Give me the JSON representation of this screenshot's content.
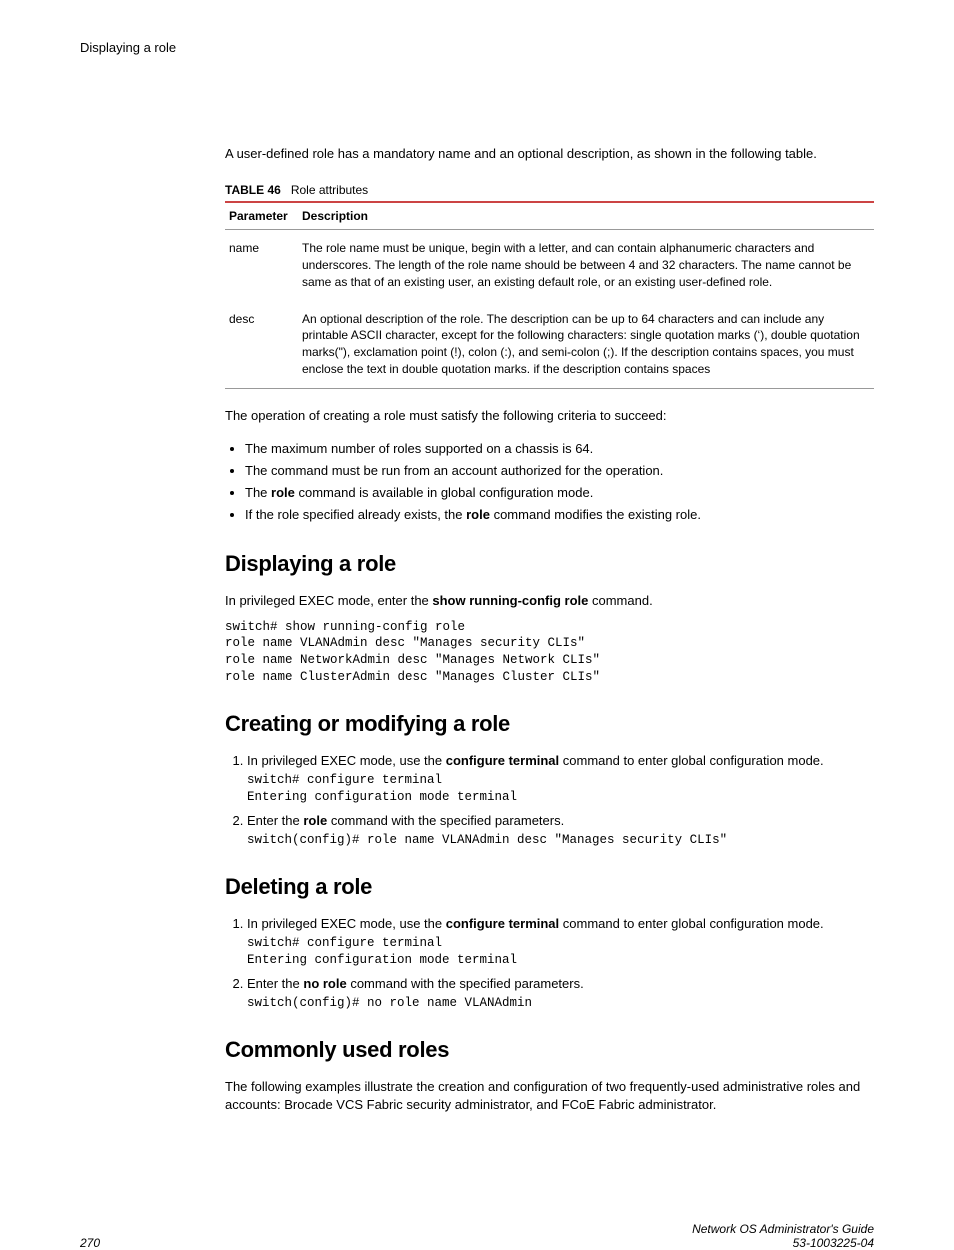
{
  "header": "Displaying a role",
  "intro": "A user-defined role has a mandatory name and an optional description, as shown in the following table.",
  "table": {
    "label": "TABLE 46",
    "title": "Role attributes",
    "col1": "Parameter",
    "col2": "Description",
    "rows": [
      {
        "param": "name",
        "desc": "The role name must be unique, begin with a letter, and can contain alphanumeric characters and underscores. The length of the role name should be between 4 and 32 characters. The name cannot be same as that of an existing user, an existing default role, or an existing user-defined role."
      },
      {
        "param": "desc",
        "desc": "An optional description of the role. The description can be up to 64 characters and can include any printable ASCII character, except for the following characters: single quotation marks (‘), double quotation marks(\"), exclamation point (!), colon (:), and semi-colon (;). If the description contains spaces, you must enclose the text in double quotation marks. if the description contains spaces"
      }
    ]
  },
  "criteria_intro": "The operation of creating a role must satisfy the following criteria to succeed:",
  "criteria": [
    {
      "text": "The maximum number of roles supported on a chassis is 64."
    },
    {
      "text": "The command must be run from an account authorized for the operation."
    },
    {
      "pre": "The ",
      "bold": "role",
      "post": " command is available in global configuration mode."
    },
    {
      "pre": "If the role specified already exists, the ",
      "bold": "role",
      "post": " command modifies the existing role."
    }
  ],
  "sections": {
    "displaying": {
      "title": "Displaying a role",
      "intro_pre": "In privileged EXEC mode, enter the ",
      "intro_bold": "show running-config role",
      "intro_post": " command.",
      "code": "switch# show running-config role\nrole name VLANAdmin desc \"Manages security CLIs\"\nrole name NetworkAdmin desc \"Manages Network CLIs\"\nrole name ClusterAdmin desc \"Manages Cluster CLIs\""
    },
    "creating": {
      "title": "Creating or modifying a role",
      "steps": [
        {
          "pre": "In privileged EXEC mode, use the ",
          "bold": "configure terminal",
          "post": " command to enter global configuration mode.",
          "code": "switch# configure terminal\nEntering configuration mode terminal"
        },
        {
          "pre": "Enter the ",
          "bold": "role",
          "post": " command with the specified parameters.",
          "code": "switch(config)# role name VLANAdmin desc \"Manages security CLIs\""
        }
      ]
    },
    "deleting": {
      "title": "Deleting a role",
      "steps": [
        {
          "pre": "In privileged EXEC mode, use the ",
          "bold": "configure terminal",
          "post": " command to enter global configuration mode.",
          "code": "switch# configure terminal\nEntering configuration mode terminal"
        },
        {
          "pre": "Enter the ",
          "bold": "no role",
          "post": " command with the specified parameters.",
          "code": "switch(config)# no role name VLANAdmin"
        }
      ]
    },
    "common": {
      "title": "Commonly used roles",
      "text": "The following examples illustrate the creation and configuration of two frequently-used administrative roles and accounts: Brocade VCS Fabric security administrator, and FCoE Fabric administrator."
    }
  },
  "footer": {
    "page": "270",
    "guide": "Network OS Administrator's Guide",
    "docnum": "53-1003225-04"
  }
}
